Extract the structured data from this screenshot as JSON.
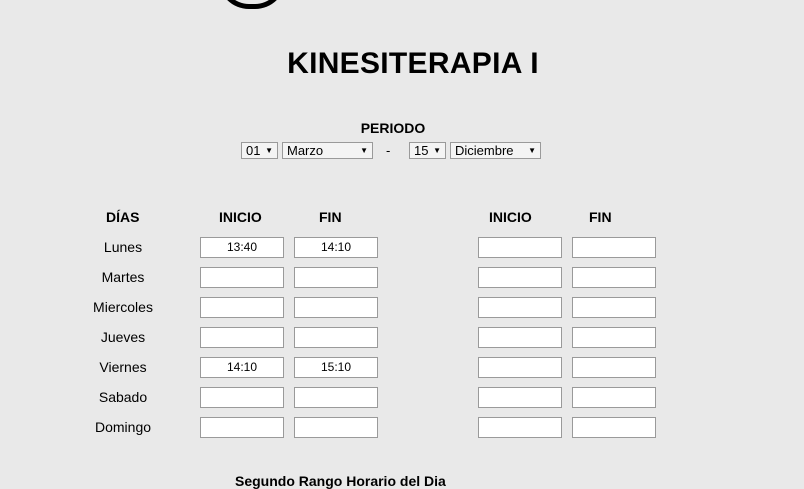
{
  "logo": {
    "icon": "circle-logo-icon"
  },
  "title": "KINESITERAPIA I",
  "periodo": {
    "label": "PERIODO",
    "start_day": "01",
    "start_month": "Marzo",
    "separator": "-",
    "end_day": "15",
    "end_month": "Diciembre"
  },
  "headers": {
    "dias": "DÍAS",
    "inicio": "INICIO",
    "fin": "FIN",
    "inicio2": "INICIO",
    "fin2": "FIN"
  },
  "days": [
    {
      "name": "Lunes",
      "inicio": "13:40",
      "fin": "14:10",
      "inicio2": "",
      "fin2": ""
    },
    {
      "name": "Martes",
      "inicio": "",
      "fin": "",
      "inicio2": "",
      "fin2": ""
    },
    {
      "name": "Miercoles",
      "inicio": "",
      "fin": "",
      "inicio2": "",
      "fin2": ""
    },
    {
      "name": "Jueves",
      "inicio": "",
      "fin": "",
      "inicio2": "",
      "fin2": ""
    },
    {
      "name": "Viernes",
      "inicio": "14:10",
      "fin": "15:10",
      "inicio2": "",
      "fin2": ""
    },
    {
      "name": "Sabado",
      "inicio": "",
      "fin": "",
      "inicio2": "",
      "fin2": ""
    },
    {
      "name": "Domingo",
      "inicio": "",
      "fin": "",
      "inicio2": "",
      "fin2": ""
    }
  ],
  "footer": {
    "label": "Segundo Rango Horario del Dia"
  }
}
